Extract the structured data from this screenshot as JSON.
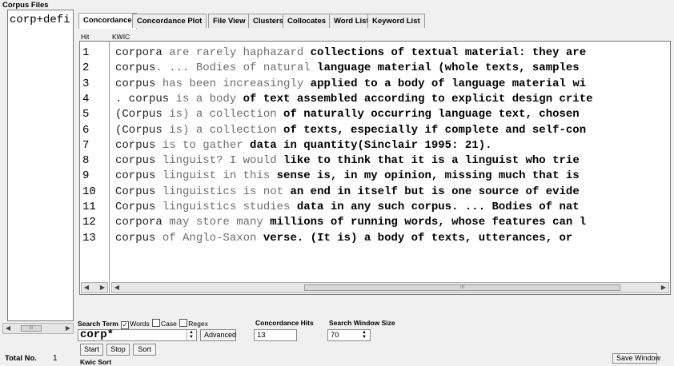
{
  "left_panel": {
    "title": "Corpus Files",
    "files": [
      "corp+defi"
    ],
    "total_label": "Total No.",
    "total_value": "1"
  },
  "tabs": [
    {
      "label": "Concordance",
      "active": true
    },
    {
      "label": "Concordance Plot",
      "active": false
    },
    {
      "label": "File View",
      "active": false
    },
    {
      "label": "Clusters",
      "active": false
    },
    {
      "label": "Collocates",
      "active": false
    },
    {
      "label": "Word List",
      "active": false
    },
    {
      "label": "Keyword List",
      "active": false
    }
  ],
  "table": {
    "hit_header": "Hit",
    "kwic_header": "KWIC",
    "rows": [
      {
        "hit": "1",
        "parts": [
          [
            "corpora",
            "w"
          ],
          [
            " are rarely haphazard",
            "g"
          ],
          [
            " collections of textual material: they are",
            "b"
          ]
        ]
      },
      {
        "hit": "2",
        "parts": [
          [
            "corpus",
            "w"
          ],
          [
            ". ... Bodies of natural",
            "g"
          ],
          [
            " language material (whole texts, samples",
            "b"
          ]
        ]
      },
      {
        "hit": "3",
        "parts": [
          [
            "corpus",
            "w"
          ],
          [
            " has been increasingly",
            "g"
          ],
          [
            " applied to a body of language material wi",
            "b"
          ]
        ]
      },
      {
        "hit": "4",
        "parts": [
          [
            ". corpus",
            "w"
          ],
          [
            " is a body",
            "g"
          ],
          [
            " of text assembled according to explicit design crite",
            "b"
          ]
        ]
      },
      {
        "hit": "5",
        "parts": [
          [
            "(Corpus",
            "w"
          ],
          [
            " is) a collection",
            "g"
          ],
          [
            " of naturally occurring language text, chosen",
            "b"
          ]
        ]
      },
      {
        "hit": "6",
        "parts": [
          [
            "(Corpus",
            "w"
          ],
          [
            " is) a collection",
            "g"
          ],
          [
            " of texts, especially if complete and self-con",
            "b"
          ]
        ]
      },
      {
        "hit": "7",
        "parts": [
          [
            "corpus",
            "w"
          ],
          [
            " is to gather",
            "g"
          ],
          [
            " data in quantity(Sinclair 1995: 21).",
            "b"
          ]
        ]
      },
      {
        "hit": "8",
        "parts": [
          [
            "corpus",
            "w"
          ],
          [
            " linguist? I would",
            "g"
          ],
          [
            " like to think that it is a linguist who trie",
            "b"
          ]
        ]
      },
      {
        "hit": "9",
        "parts": [
          [
            "corpus",
            "w"
          ],
          [
            " linguist in this",
            "g"
          ],
          [
            " sense is, in my opinion, missing much that is",
            "b"
          ]
        ]
      },
      {
        "hit": "10",
        "parts": [
          [
            "Corpus",
            "w"
          ],
          [
            " linguistics is not",
            "g"
          ],
          [
            " an end in itself but is one source of evide",
            "b"
          ]
        ]
      },
      {
        "hit": "11",
        "parts": [
          [
            "Corpus",
            "w"
          ],
          [
            " linguistics studies",
            "g"
          ],
          [
            " data in any such corpus. ... Bodies of nat",
            "b"
          ]
        ]
      },
      {
        "hit": "12",
        "parts": [
          [
            "corpora",
            "w"
          ],
          [
            " may store many",
            "g"
          ],
          [
            " millions of running words, whose features can l",
            "b"
          ]
        ]
      },
      {
        "hit": "13",
        "parts": [
          [
            "corpus",
            "w"
          ],
          [
            " of Anglo-Saxon",
            "g"
          ],
          [
            " verse. (It is) a body of texts, utterances, or",
            "b"
          ]
        ]
      }
    ]
  },
  "search": {
    "term_label": "Search Term",
    "words_label": "Words",
    "case_label": "Case",
    "regex_label": "Regex",
    "words_checked": true,
    "case_checked": false,
    "regex_checked": false,
    "term_value": "corp*",
    "advanced_label": "Advanced",
    "start_label": "Start",
    "stop_label": "Stop",
    "sort_label": "Sort",
    "kwic_sort_label": "Kwic Sort"
  },
  "hits": {
    "label": "Concordance Hits",
    "value": "13"
  },
  "window_size": {
    "label": "Search Window Size",
    "value": "70"
  },
  "save_window_label": "Save Window",
  "scroll_thumb_marks": "III",
  "colors": {
    "background": "#f0f0f0",
    "keyword": "#222222",
    "left_context": "#6e6e6e",
    "right_context": "#000000"
  },
  "icons": [
    "chevron-left-icon",
    "chevron-right-icon",
    "spinner-icon",
    "checkbox-icon"
  ]
}
